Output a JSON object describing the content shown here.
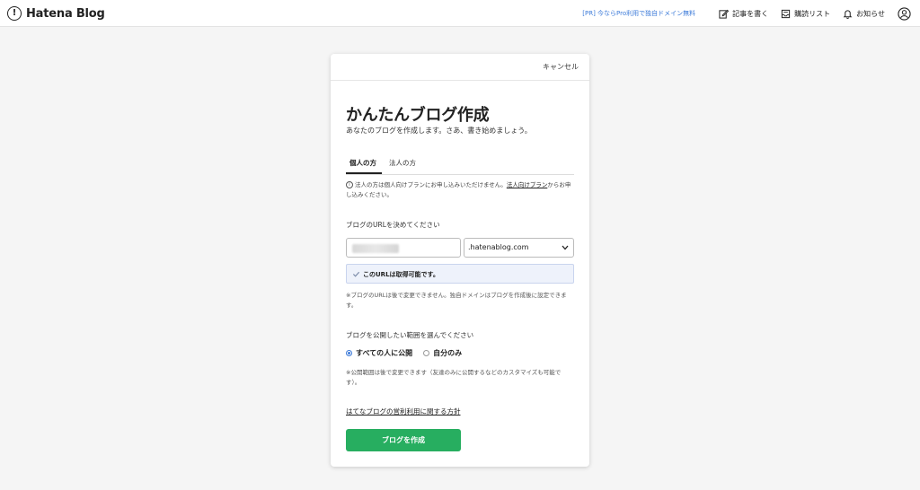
{
  "header": {
    "brand": "Hatena Blog",
    "logo_glyph": "!",
    "pr_link": "[PR] 今ならPro利用で独自ドメイン無料",
    "write_label": "記事を書く",
    "reading_list_label": "購読リスト",
    "notifications_label": "お知らせ",
    "accent_color": "#3d7bd9"
  },
  "card": {
    "cancel_label": "キャンセル",
    "title": "かんたんブログ作成",
    "subtitle": "あなたのブログを作成します。さあ、書き始めましょう。",
    "tabs": [
      {
        "label": "個人の方",
        "active": true
      },
      {
        "label": "法人の方",
        "active": false
      }
    ],
    "notice": {
      "prefix": "法人の方は個人向けプランにお申し込みいただけません。",
      "link": "法人向けプラン",
      "suffix": "からお申し込みください。"
    },
    "url_section_label": "ブログのURLを決めてください",
    "domain_selected": ".hatenablog.com",
    "availability_message": "このURLは取得可能です。",
    "url_note": "※ブログのURLは後で変更できません。独自ドメインはブログを作成後に設定できます。",
    "visibility_label": "ブログを公開したい範囲を選んでください",
    "visibility_options": [
      {
        "label": "すべての人に公開",
        "checked": true
      },
      {
        "label": "自分のみ",
        "checked": false
      }
    ],
    "visibility_note": "※公開範囲は後で変更できます（友達のみに公開するなどのカスタマイズも可能です）。",
    "policy_link": "はてなブログの営利利用に関する方針",
    "create_button": "ブログを作成",
    "button_color": "#27ae60"
  }
}
